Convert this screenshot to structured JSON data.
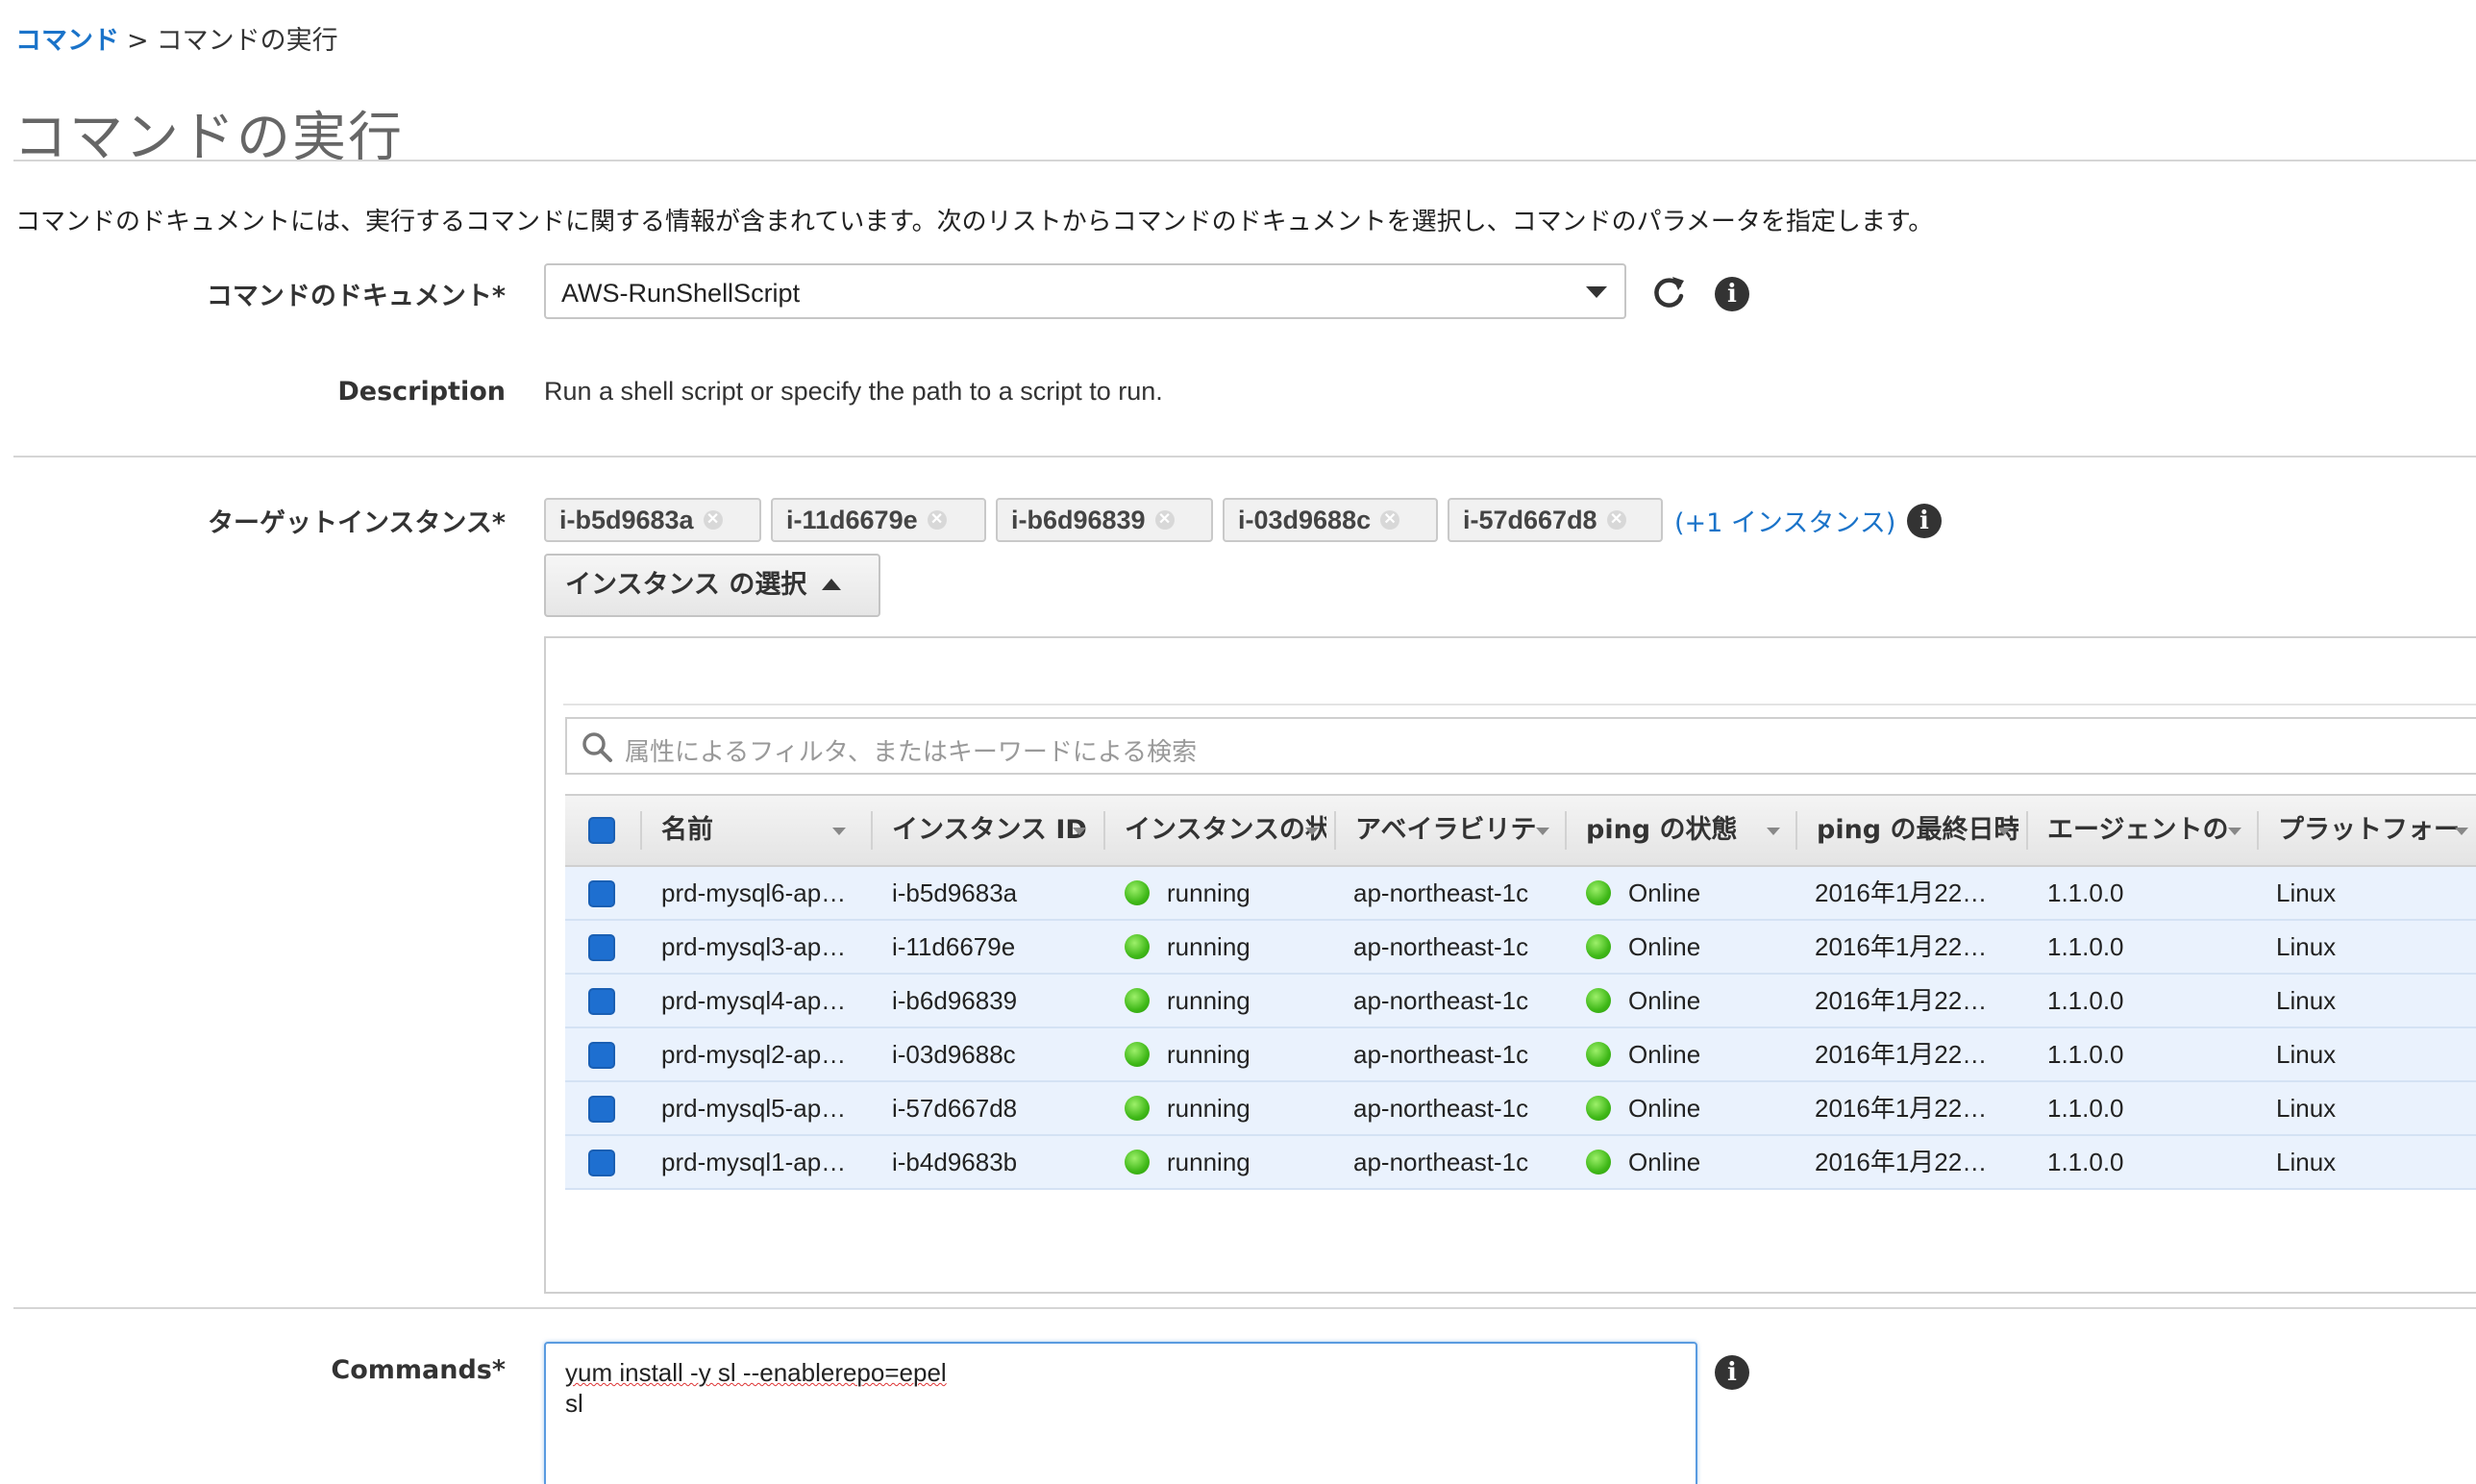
{
  "breadcrumb": {
    "root": "コマンド",
    "separator": ">",
    "current": "コマンドの実行"
  },
  "page_title": "コマンドの実行",
  "intro": "コマンドのドキュメントには、実行するコマンドに関する情報が含まれています。次のリストからコマンドのドキュメントを選択し、コマンドのパラメータを指定します。",
  "document": {
    "label": "コマンドのドキュメント*",
    "selected": "AWS-RunShellScript",
    "description_label": "Description",
    "description": "Run a shell script or specify the path to a script to run."
  },
  "targets": {
    "label": "ターゲットインスタンス*",
    "chips": [
      "i-b5d9683a",
      "i-11d6679e",
      "i-b6d96839",
      "i-03d9688c",
      "i-57d667d8"
    ],
    "more": "(+1 インスタンス)",
    "select_button": "インスタンス の選択"
  },
  "search": {
    "placeholder": "属性によるフィルタ、またはキーワードによる検索"
  },
  "table": {
    "columns": [
      "名前",
      "インスタンス ID",
      "インスタンスの状",
      "アベイラビリテ",
      "ping の状態",
      "ping の最終日時",
      "エージェントの",
      "プラットフォー"
    ],
    "rows": [
      {
        "name": "prd-mysql6-ap…",
        "id": "i-b5d9683a",
        "state": "running",
        "az": "ap-northeast-1c",
        "ping": "Online",
        "last_ping": "2016年1月22…",
        "agent": "1.1.0.0",
        "platform": "Linux"
      },
      {
        "name": "prd-mysql3-ap…",
        "id": "i-11d6679e",
        "state": "running",
        "az": "ap-northeast-1c",
        "ping": "Online",
        "last_ping": "2016年1月22…",
        "agent": "1.1.0.0",
        "platform": "Linux"
      },
      {
        "name": "prd-mysql4-ap…",
        "id": "i-b6d96839",
        "state": "running",
        "az": "ap-northeast-1c",
        "ping": "Online",
        "last_ping": "2016年1月22…",
        "agent": "1.1.0.0",
        "platform": "Linux"
      },
      {
        "name": "prd-mysql2-ap…",
        "id": "i-03d9688c",
        "state": "running",
        "az": "ap-northeast-1c",
        "ping": "Online",
        "last_ping": "2016年1月22…",
        "agent": "1.1.0.0",
        "platform": "Linux"
      },
      {
        "name": "prd-mysql5-ap…",
        "id": "i-57d667d8",
        "state": "running",
        "az": "ap-northeast-1c",
        "ping": "Online",
        "last_ping": "2016年1月22…",
        "agent": "1.1.0.0",
        "platform": "Linux"
      },
      {
        "name": "prd-mysql1-ap…",
        "id": "i-b4d9683b",
        "state": "running",
        "az": "ap-northeast-1c",
        "ping": "Online",
        "last_ping": "2016年1月22…",
        "agent": "1.1.0.0",
        "platform": "Linux"
      }
    ]
  },
  "commands": {
    "label": "Commands*",
    "line1": "yum install -y sl --enablerepo=epel",
    "line2": "sl"
  },
  "icons": {
    "refresh": "refresh-icon",
    "info": "info-icon",
    "search": "search-icon",
    "remove": "close-icon",
    "status_ok": "green-status-dot"
  },
  "colors": {
    "link": "#1a73c9",
    "checkbox": "#1e6fd0",
    "row_selected": "#eaf2fd",
    "status_green": "#3fb818"
  }
}
